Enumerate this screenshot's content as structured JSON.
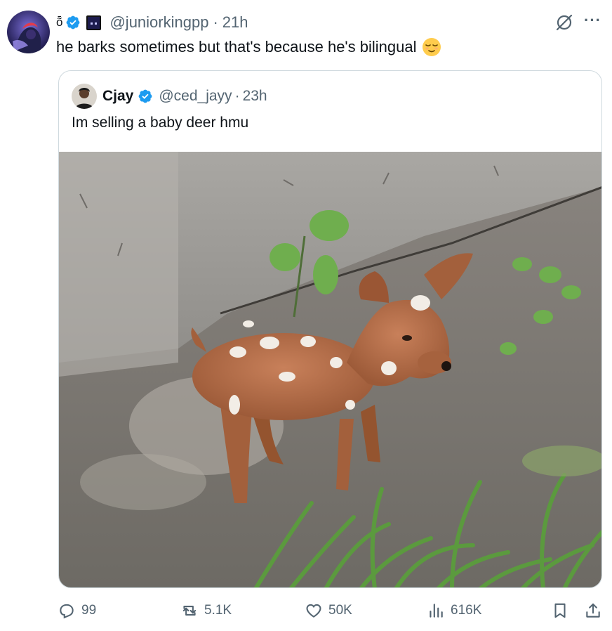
{
  "author": {
    "display_prefix": "ȭ",
    "handle": "@juniorkingpp",
    "time": "21h",
    "verified": true
  },
  "tweet_text": "he barks sometimes but that's because he's bilingual",
  "quoted": {
    "name": "Cjay",
    "handle": "@ced_jayy",
    "time": "23h",
    "verified": true,
    "text": "Im selling a baby deer hmu"
  },
  "metrics": {
    "replies": "99",
    "retweets": "5.1K",
    "likes": "50K",
    "views": "616K"
  },
  "colors": {
    "verified": "#1d9bf0",
    "muted": "#536471",
    "border": "#cfd9de"
  },
  "icons": [
    "grok-icon",
    "more-icon",
    "reply-icon",
    "retweet-icon",
    "like-icon",
    "views-icon",
    "bookmark-icon",
    "share-icon"
  ]
}
